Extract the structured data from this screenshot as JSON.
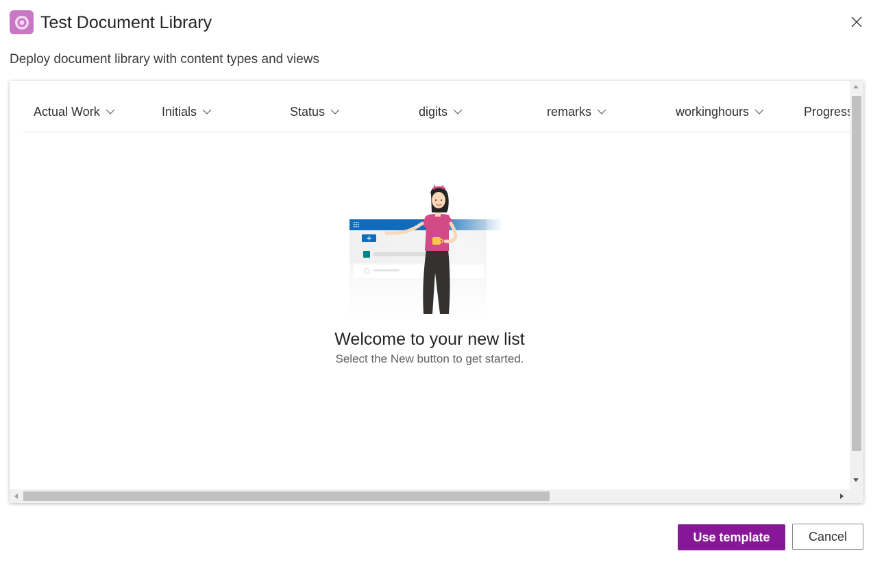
{
  "dialog": {
    "title": "Test Document Library",
    "subtitle": "Deploy document library with content types and views",
    "close_icon": "close-icon",
    "app_icon": "list-template-icon"
  },
  "columns": [
    {
      "label": "Actual Work"
    },
    {
      "label": "Initials"
    },
    {
      "label": "Status"
    },
    {
      "label": "digits"
    },
    {
      "label": "remarks"
    },
    {
      "label": "workinghours"
    },
    {
      "label": "Progress"
    }
  ],
  "empty_state": {
    "heading": "Welcome to your new list",
    "subtext": "Select the New button to get started."
  },
  "footer": {
    "primary_label": "Use template",
    "secondary_label": "Cancel"
  },
  "colors": {
    "accent": "#881798",
    "app_icon_bg": "#c777c4",
    "illustration_blue": "#0f6cbd",
    "illustration_pink": "#d34a86"
  }
}
